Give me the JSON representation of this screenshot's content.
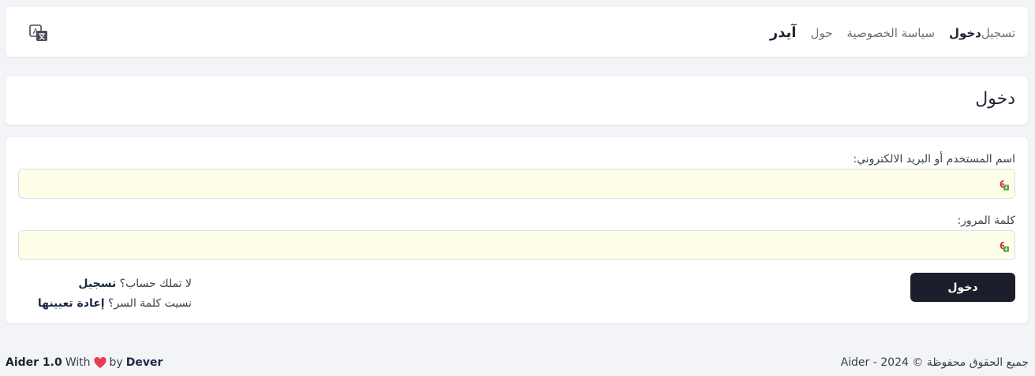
{
  "nav": {
    "brand": "آيدر",
    "links": [
      {
        "label": "حول",
        "active": false
      },
      {
        "label": "سياسة الخصوصية",
        "active": false
      },
      {
        "label": "دخول",
        "active": true
      },
      {
        "label": "تسجيل",
        "active": false
      }
    ],
    "lang_icon": "translate-icon"
  },
  "page": {
    "title": "دخول"
  },
  "form": {
    "username_label": "اسم المستخدم أو البريد الالكتروني:",
    "username_value": "",
    "password_label": "كلمة المرور:",
    "password_value": "",
    "field_icon": "password-manager-icon",
    "field_bg": "#fefee9",
    "submit_label": "دخول",
    "no_account_text": "لا تملك حساب؟",
    "register_link": "تسجيل",
    "forgot_text": "نسيت كلمة السر؟",
    "reset_link": "إعادة تعيينها"
  },
  "footer": {
    "app_version": "Aider 1.0",
    "with_text": "With",
    "heart_icon": "heart-icon",
    "by_text": "by",
    "author": "Dever",
    "copyright": "جميع الحقوق محفوظة © 2024 - Aider"
  },
  "colors": {
    "background": "#f3f4f8",
    "button": "#1c1f2b",
    "heart": "#e53b4f"
  }
}
